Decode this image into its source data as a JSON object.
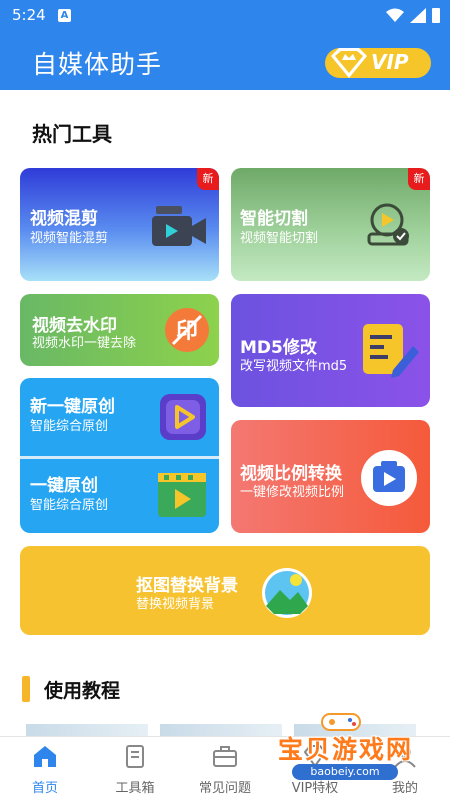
{
  "status_bar": {
    "time": "5:24",
    "notification_icon": "A"
  },
  "app_bar": {
    "title": "自媒体助手",
    "vip_label": "VIP"
  },
  "hot_tools": {
    "title": "热门工具",
    "cards": [
      {
        "title": "视频混剪",
        "subtitle": "视频智能混剪",
        "badge": "新",
        "icon": "video-camera-icon"
      },
      {
        "title": "智能切割",
        "subtitle": "视频智能切割",
        "badge": "新",
        "icon": "video-cut-icon"
      },
      {
        "title": "视频去水印",
        "subtitle": "视频水印一键去除",
        "icon": "watermark-remove-icon"
      },
      {
        "title": "MD5修改",
        "subtitle": "改写视频文件md5",
        "icon": "edit-document-icon"
      },
      {
        "title": "新一键原创",
        "subtitle": "智能综合原创",
        "icon": "play-square-icon"
      },
      {
        "title": "一键原创",
        "subtitle": "智能综合原创",
        "icon": "film-play-icon"
      },
      {
        "title": "视频比例转换",
        "subtitle": "一键修改视频比例",
        "icon": "aspect-ratio-icon"
      },
      {
        "title": "抠图替换背景",
        "subtitle": "替换视频背景",
        "icon": "landscape-icon"
      }
    ]
  },
  "tutorials": {
    "title": "使用教程"
  },
  "bottom_nav": [
    {
      "label": "首页",
      "icon": "home-icon",
      "active": true
    },
    {
      "label": "工具箱",
      "icon": "toolbox-icon",
      "active": false
    },
    {
      "label": "常见问题",
      "icon": "briefcase-icon",
      "active": false
    },
    {
      "label": "VIP特权",
      "icon": "vip-icon",
      "active": false
    },
    {
      "label": "我的",
      "icon": "profile-icon",
      "active": false
    }
  ],
  "watermark": {
    "text": "宝贝游戏网",
    "url": "baobeiy.com"
  },
  "colors": {
    "primary": "#2e86ec",
    "vip_gold": "#f5c52a",
    "badge_red": "#e81c1c",
    "nav_active": "#2e86ec"
  }
}
